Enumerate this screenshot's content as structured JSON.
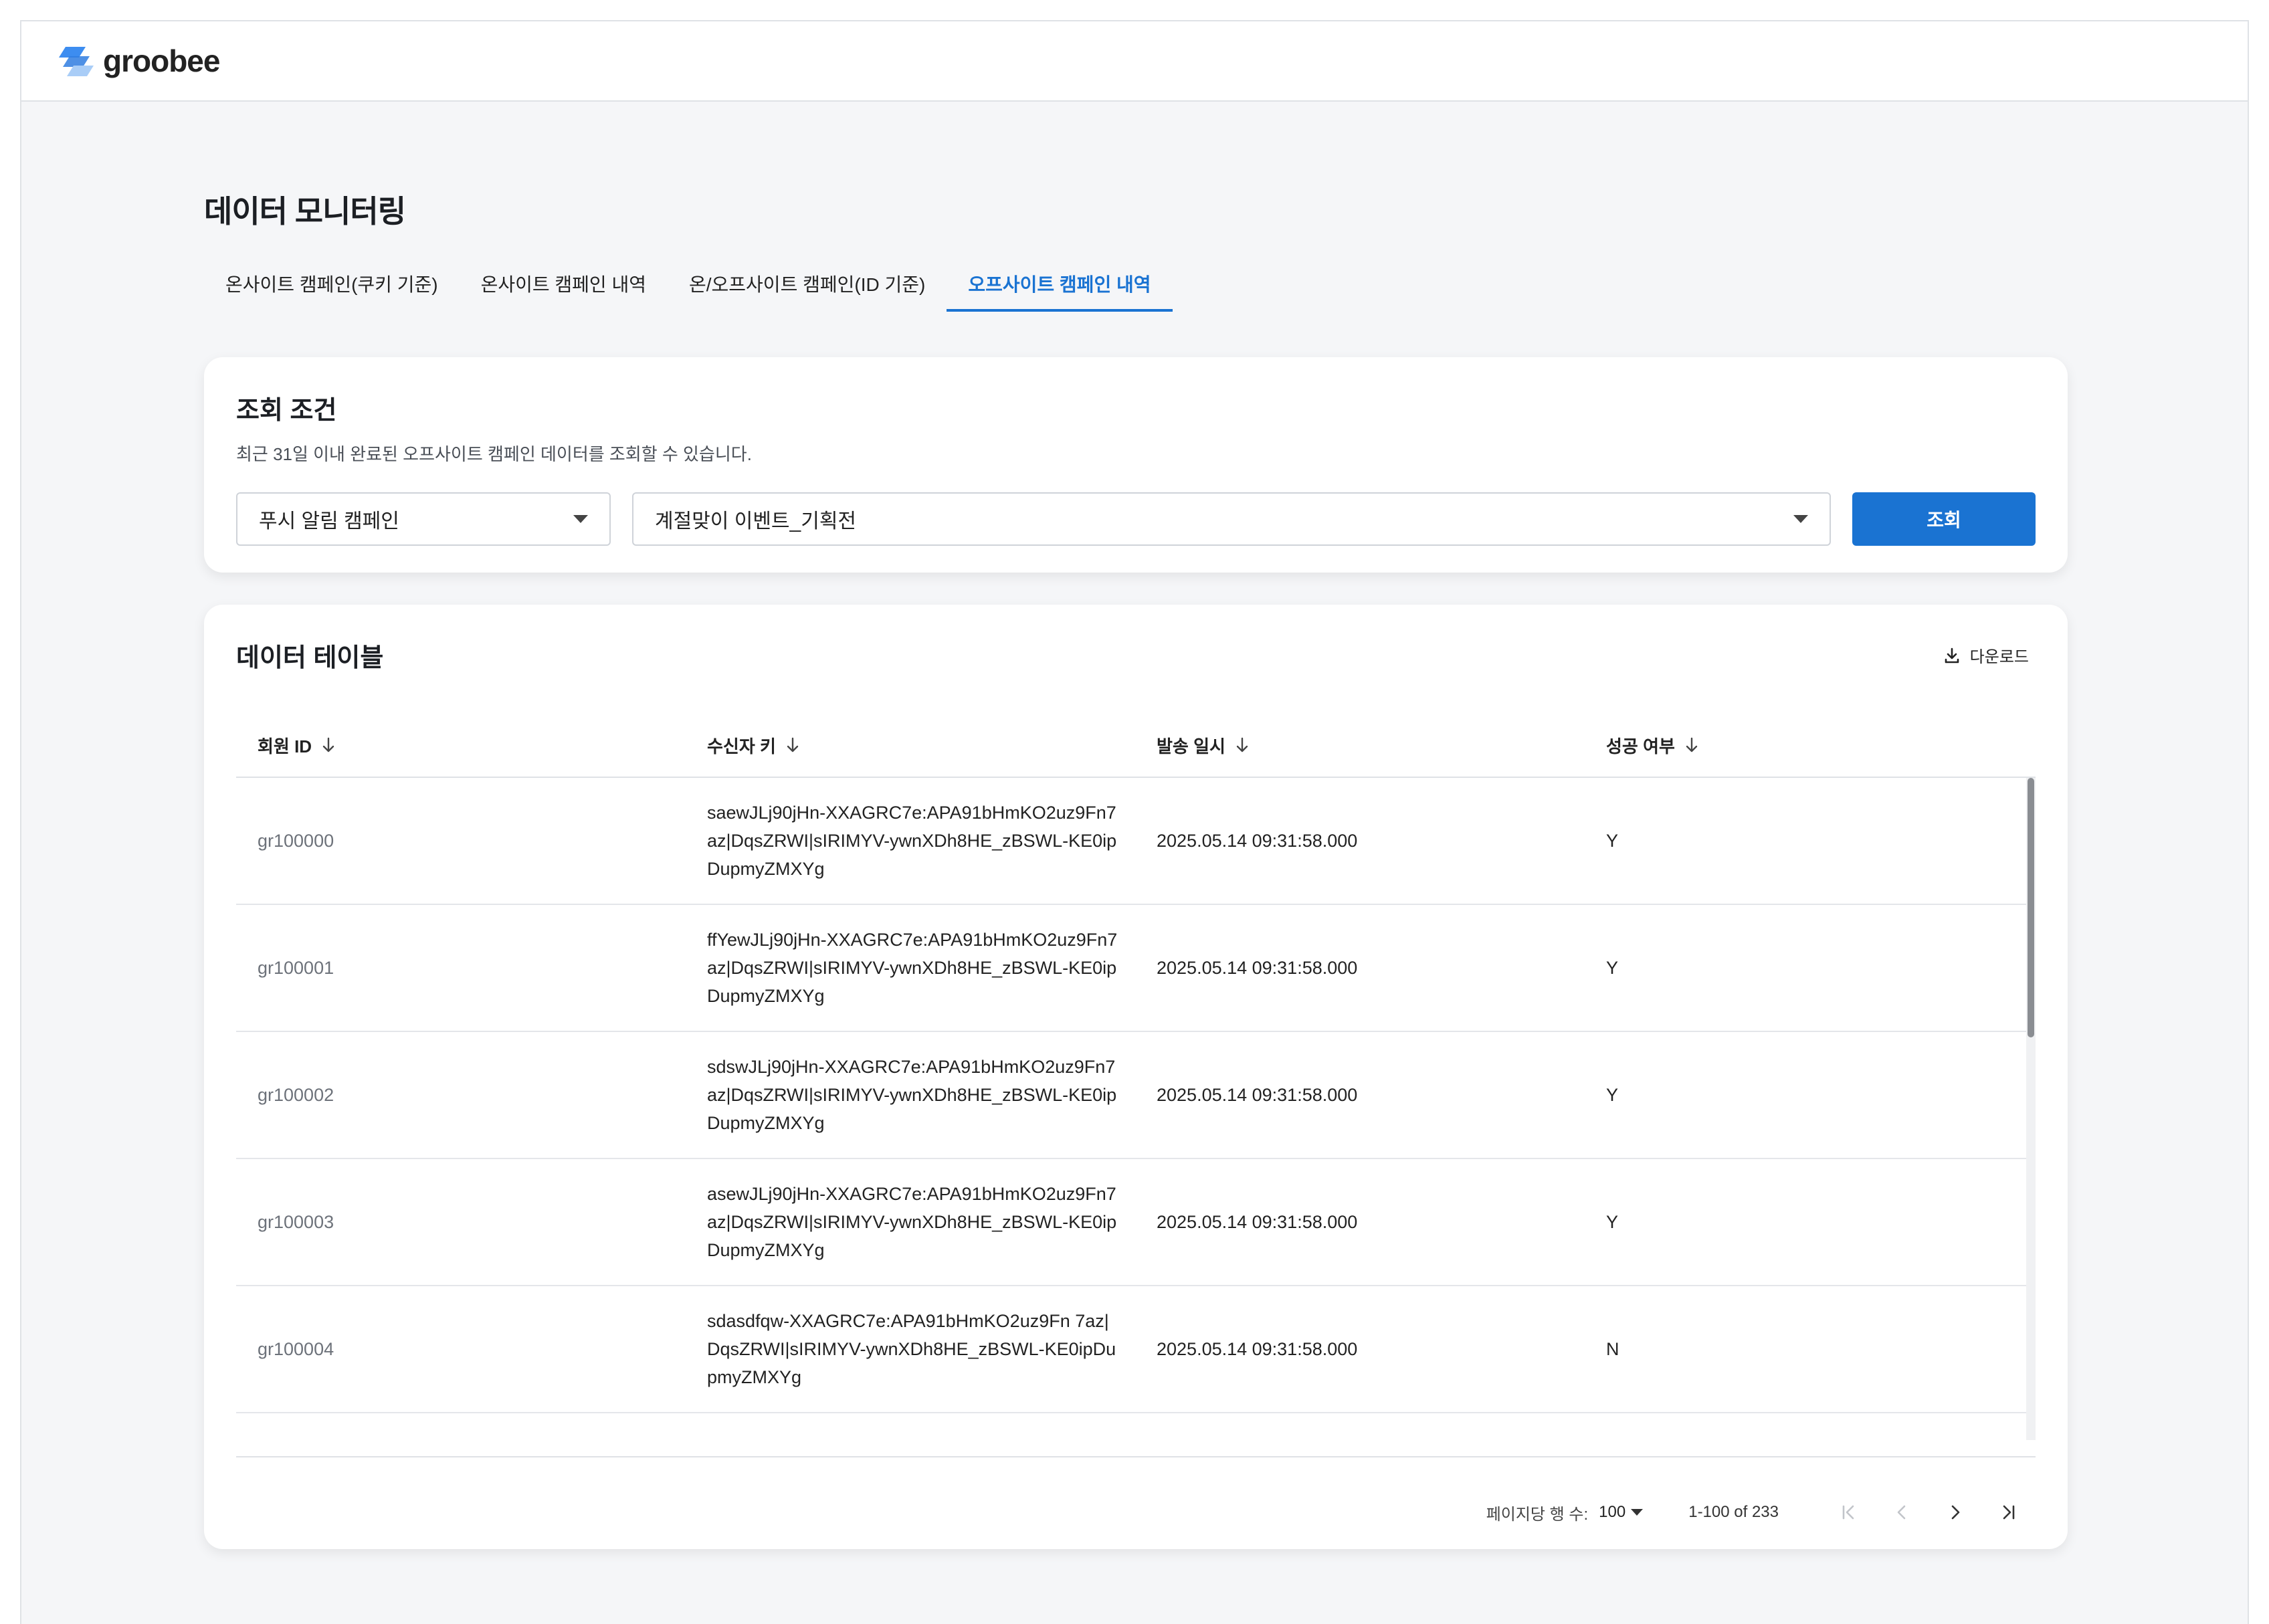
{
  "header": {
    "logo_text": "groobee",
    "logo_color": "#2f7de1"
  },
  "page": {
    "title": "데이터 모니터링"
  },
  "tabs": [
    {
      "label": "온사이트 캠페인(쿠키 기준)",
      "active": false
    },
    {
      "label": "온사이트 캠페인 내역",
      "active": false
    },
    {
      "label": "온/오프사이트 캠페인(ID 기준)",
      "active": false
    },
    {
      "label": "오프사이트 캠페인 내역",
      "active": true
    }
  ],
  "conditions": {
    "title": "조회 조건",
    "subtitle": "최근 31일 이내 완료된 오프사이트 캠페인 데이터를 조회할 수 있습니다.",
    "campaign_type": "푸시 알림 캠페인",
    "campaign_name": "계절맞이 이벤트_기획전",
    "search_label": "조회"
  },
  "table": {
    "title": "데이터 테이블",
    "download_label": "다운로드",
    "columns": [
      "회원 ID",
      "수신자 키",
      "발송 일시",
      "성공 여부"
    ],
    "rows": [
      {
        "id": "gr100000",
        "key": "saewJLj90jHn-XXAGRC7e:APA91bHmKO2uz9Fn7az|DqsZRWI|sIRIMYV-ywnXDh8HE_zBSWL-KE0ipDupmyZMXYg",
        "sent": "2025.05.14 09:31:58.000",
        "success": "Y"
      },
      {
        "id": "gr100001",
        "key": "ffYewJLj90jHn-XXAGRC7e:APA91bHmKO2uz9Fn7az|DqsZRWI|sIRIMYV-ywnXDh8HE_zBSWL-KE0ipDupmyZMXYg",
        "sent": "2025.05.14 09:31:58.000",
        "success": "Y"
      },
      {
        "id": "gr100002",
        "key": "sdswJLj90jHn-XXAGRC7e:APA91bHmKO2uz9Fn7az|DqsZRWI|sIRIMYV-ywnXDh8HE_zBSWL-KE0ipDupmyZMXYg",
        "sent": "2025.05.14 09:31:58.000",
        "success": "Y"
      },
      {
        "id": "gr100003",
        "key": "asewJLj90jHn-XXAGRC7e:APA91bHmKO2uz9Fn7az|DqsZRWI|sIRIMYV-ywnXDh8HE_zBSWL-KE0ipDupmyZMXYg",
        "sent": "2025.05.14 09:31:58.000",
        "success": "Y"
      },
      {
        "id": "gr100004",
        "key": "sdasdfqw-XXAGRC7e:APA91bHmKO2uz9Fn 7az|DqsZRWI|sIRIMYV-ywnXDh8HE_zBSWL-KE0ipDupmyZMXYg",
        "sent": "2025.05.14 09:31:58.000",
        "success": "N"
      }
    ]
  },
  "pagination": {
    "rows_per_page_label": "페이지당 행 수:",
    "rows_per_page": "100",
    "range_text": "1-100 of 233"
  }
}
